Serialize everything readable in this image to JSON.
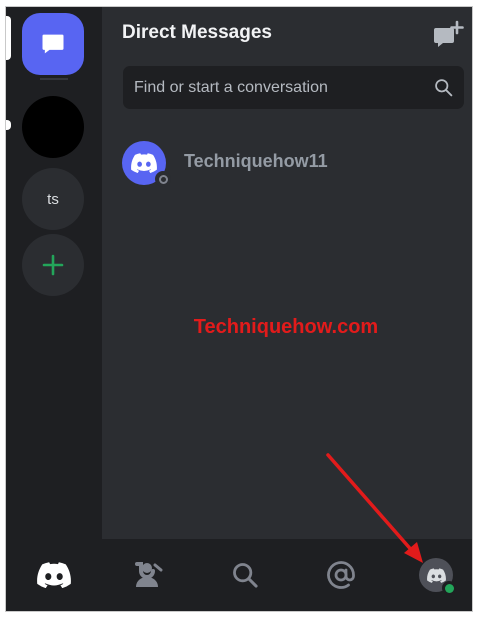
{
  "header": {
    "title": "Direct Messages"
  },
  "search": {
    "placeholder": "Find or start a conversation"
  },
  "rail": {
    "servers": [
      {
        "label": "ts"
      }
    ]
  },
  "direct_messages": [
    {
      "name": "Techniquehow11",
      "status": "offline"
    }
  ],
  "watermark": "Techniquehow.com",
  "bottom_nav": {
    "items": [
      "home-icon",
      "friends-icon",
      "search-icon",
      "mentions-icon",
      "profile-avatar"
    ],
    "profile_status": "online"
  },
  "colors": {
    "blurple": "#5865f2",
    "online": "#23a55a",
    "annotation_arrow": "#e21b1b"
  }
}
